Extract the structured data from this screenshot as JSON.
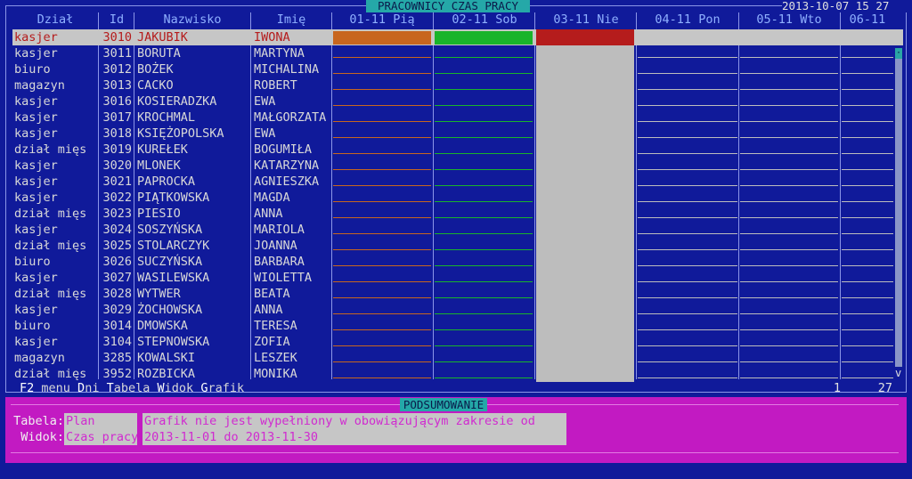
{
  "window": {
    "title": "PRACOWNICY CZAS PRACY",
    "clock": "2013-10-07 15 27"
  },
  "columns": {
    "dzial": "Dział",
    "id": "Id",
    "nazwisko": "Nazwisko",
    "imie": "Imię",
    "days": [
      "01-11 Pią",
      "02-11 Sob",
      "03-11 Nie",
      "04-11 Pon",
      "05-11 Wto",
      "06-11"
    ]
  },
  "rows": [
    {
      "dzial": "kasjer",
      "id": "3010",
      "nazwisko": "JAKUBIK",
      "imie": "IWONA"
    },
    {
      "dzial": "kasjer",
      "id": "3011",
      "nazwisko": "BORUTA",
      "imie": "MARTYNA"
    },
    {
      "dzial": "biuro",
      "id": "3012",
      "nazwisko": "BOŻEK",
      "imie": "MICHALINA"
    },
    {
      "dzial": "magazyn",
      "id": "3013",
      "nazwisko": "CACKO",
      "imie": "ROBERT"
    },
    {
      "dzial": "kasjer",
      "id": "3016",
      "nazwisko": "KOSIERADZKA",
      "imie": "EWA"
    },
    {
      "dzial": "kasjer",
      "id": "3017",
      "nazwisko": "KROCHMAL",
      "imie": "MAŁGORZATA"
    },
    {
      "dzial": "kasjer",
      "id": "3018",
      "nazwisko": "KSIĘŻOPOLSKA",
      "imie": "EWA"
    },
    {
      "dzial": "dział mięs",
      "id": "3019",
      "nazwisko": "KUREŁEK",
      "imie": "BOGUMIŁA"
    },
    {
      "dzial": "kasjer",
      "id": "3020",
      "nazwisko": "MLONEK",
      "imie": "KATARZYNA"
    },
    {
      "dzial": "kasjer",
      "id": "3021",
      "nazwisko": "PAPROCKA",
      "imie": "AGNIESZKA"
    },
    {
      "dzial": "kasjer",
      "id": "3022",
      "nazwisko": "PIĄTKOWSKA",
      "imie": "MAGDA"
    },
    {
      "dzial": "dział mięs",
      "id": "3023",
      "nazwisko": "PIESIO",
      "imie": "ANNA"
    },
    {
      "dzial": "kasjer",
      "id": "3024",
      "nazwisko": "SOSZYŃSKA",
      "imie": "MARIOLA"
    },
    {
      "dzial": "dział mięs",
      "id": "3025",
      "nazwisko": "STOLARCZYK",
      "imie": "JOANNA"
    },
    {
      "dzial": "biuro",
      "id": "3026",
      "nazwisko": "SUCZYŃSKA",
      "imie": "BARBARA"
    },
    {
      "dzial": "kasjer",
      "id": "3027",
      "nazwisko": "WASILEWSKA",
      "imie": "WIOLETTA"
    },
    {
      "dzial": "dział mięs",
      "id": "3028",
      "nazwisko": "WYTWER",
      "imie": "BEATA"
    },
    {
      "dzial": "kasjer",
      "id": "3029",
      "nazwisko": "ŻOCHOWSKA",
      "imie": "ANNA"
    },
    {
      "dzial": "biuro",
      "id": "3014",
      "nazwisko": "DMOWSKA",
      "imie": "TERESA"
    },
    {
      "dzial": "kasjer",
      "id": "3104",
      "nazwisko": "STEPNOWSKA",
      "imie": "ZOFIA"
    },
    {
      "dzial": "magazyn",
      "id": "3285",
      "nazwisko": "KOWALSKI",
      "imie": "LESZEK"
    },
    {
      "dzial": "dział mięs",
      "id": "3952",
      "nazwisko": "ROZBICKA",
      "imie": "MONIKA"
    }
  ],
  "menu": [
    {
      "key": "F2",
      "rest": " menu"
    },
    {
      "key": "D",
      "rest": "ni"
    },
    {
      "key": "T",
      "rest": "abela"
    },
    {
      "key": "W",
      "rest": "idok"
    },
    {
      "key": "G",
      "rest": "rafik"
    }
  ],
  "counter": {
    "position": "1",
    "total": "27"
  },
  "scroll_arrow": "v",
  "summary": {
    "title": "PODSUMOWANIE",
    "tabela_label": "Tabela:",
    "tabela_value": "Plan",
    "widok_label": "Widok:",
    "widok_value": "Czas pracy",
    "message_line1": "Grafik nie jest wypełniony w obowiązującym zakresie od",
    "message_line2": "2013-11-01 do 2013-11-30"
  },
  "colors": {
    "background": "#101a9a",
    "selection": "#c6c6c6",
    "friday_bar": "#c8661e",
    "saturday_bar": "#19b42a",
    "sunday_bar": "#b51c1c",
    "panel": "#c21ac2",
    "accent": "#25a8a8"
  }
}
